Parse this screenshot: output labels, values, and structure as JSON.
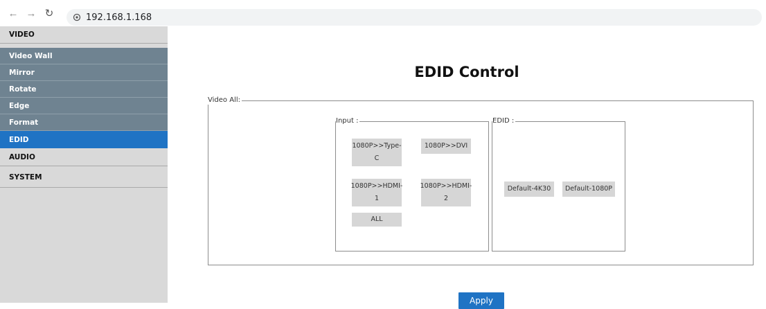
{
  "browser": {
    "url": "192.168.1.168",
    "back_icon": "arrow-left-icon",
    "forward_icon": "arrow-right-icon",
    "reload_icon": "reload-icon",
    "site_icon": "site-info-icon"
  },
  "sidebar": {
    "items": [
      {
        "label": "VIDEO",
        "kind": "main"
      },
      {
        "label": "Video Wall",
        "kind": "sub"
      },
      {
        "label": "Mirror",
        "kind": "sub"
      },
      {
        "label": "Rotate",
        "kind": "sub"
      },
      {
        "label": "Edge",
        "kind": "sub"
      },
      {
        "label": "Format",
        "kind": "sub"
      },
      {
        "label": "EDID",
        "kind": "active"
      },
      {
        "label": "AUDIO",
        "kind": "main"
      },
      {
        "label": "SYSTEM",
        "kind": "main"
      }
    ]
  },
  "main": {
    "title": "EDID Control",
    "video_all_legend": "Video All:",
    "input_legend": "Input :",
    "edid_legend": "EDID :",
    "input_buttons": {
      "type_c_line1": "1080P>>Type-",
      "type_c_line2": "C",
      "dvi": "1080P>>DVI",
      "hdmi1_line1": "1080P>>HDMI-",
      "hdmi1_line2": "1",
      "hdmi2_line1": "1080P>>HDMI-",
      "hdmi2_line2": "2",
      "all": "ALL"
    },
    "edid_buttons": {
      "default_4k30": "Default-4K30",
      "default_1080p": "Default-1080P"
    },
    "apply_label": "Apply"
  },
  "colors": {
    "sidebar_bg": "#d9d9d9",
    "sidebar_sub_bg": "#6f8391",
    "accent": "#1f73c4",
    "button_bg": "#d6d6d6"
  }
}
